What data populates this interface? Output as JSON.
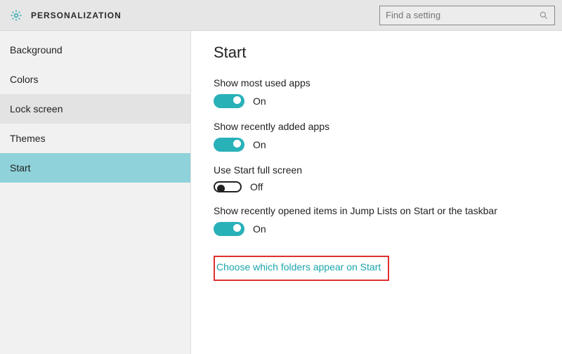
{
  "header": {
    "title": "PERSONALIZATION",
    "search_placeholder": "Find a setting"
  },
  "sidebar": {
    "items": [
      {
        "label": "Background",
        "state": "normal"
      },
      {
        "label": "Colors",
        "state": "normal"
      },
      {
        "label": "Lock screen",
        "state": "hover"
      },
      {
        "label": "Themes",
        "state": "normal"
      },
      {
        "label": "Start",
        "state": "active"
      }
    ]
  },
  "content": {
    "heading": "Start",
    "settings": [
      {
        "label": "Show most used apps",
        "on": true,
        "state_text": "On"
      },
      {
        "label": "Show recently added apps",
        "on": true,
        "state_text": "On"
      },
      {
        "label": "Use Start full screen",
        "on": false,
        "state_text": "Off"
      },
      {
        "label": "Show recently opened items in Jump Lists on Start or the taskbar",
        "on": true,
        "state_text": "On"
      }
    ],
    "link_text": "Choose which folders appear on Start"
  },
  "colors": {
    "accent": "#29b1b8",
    "highlight_border": "#e03030",
    "sidebar_active": "#8fd2d9"
  }
}
